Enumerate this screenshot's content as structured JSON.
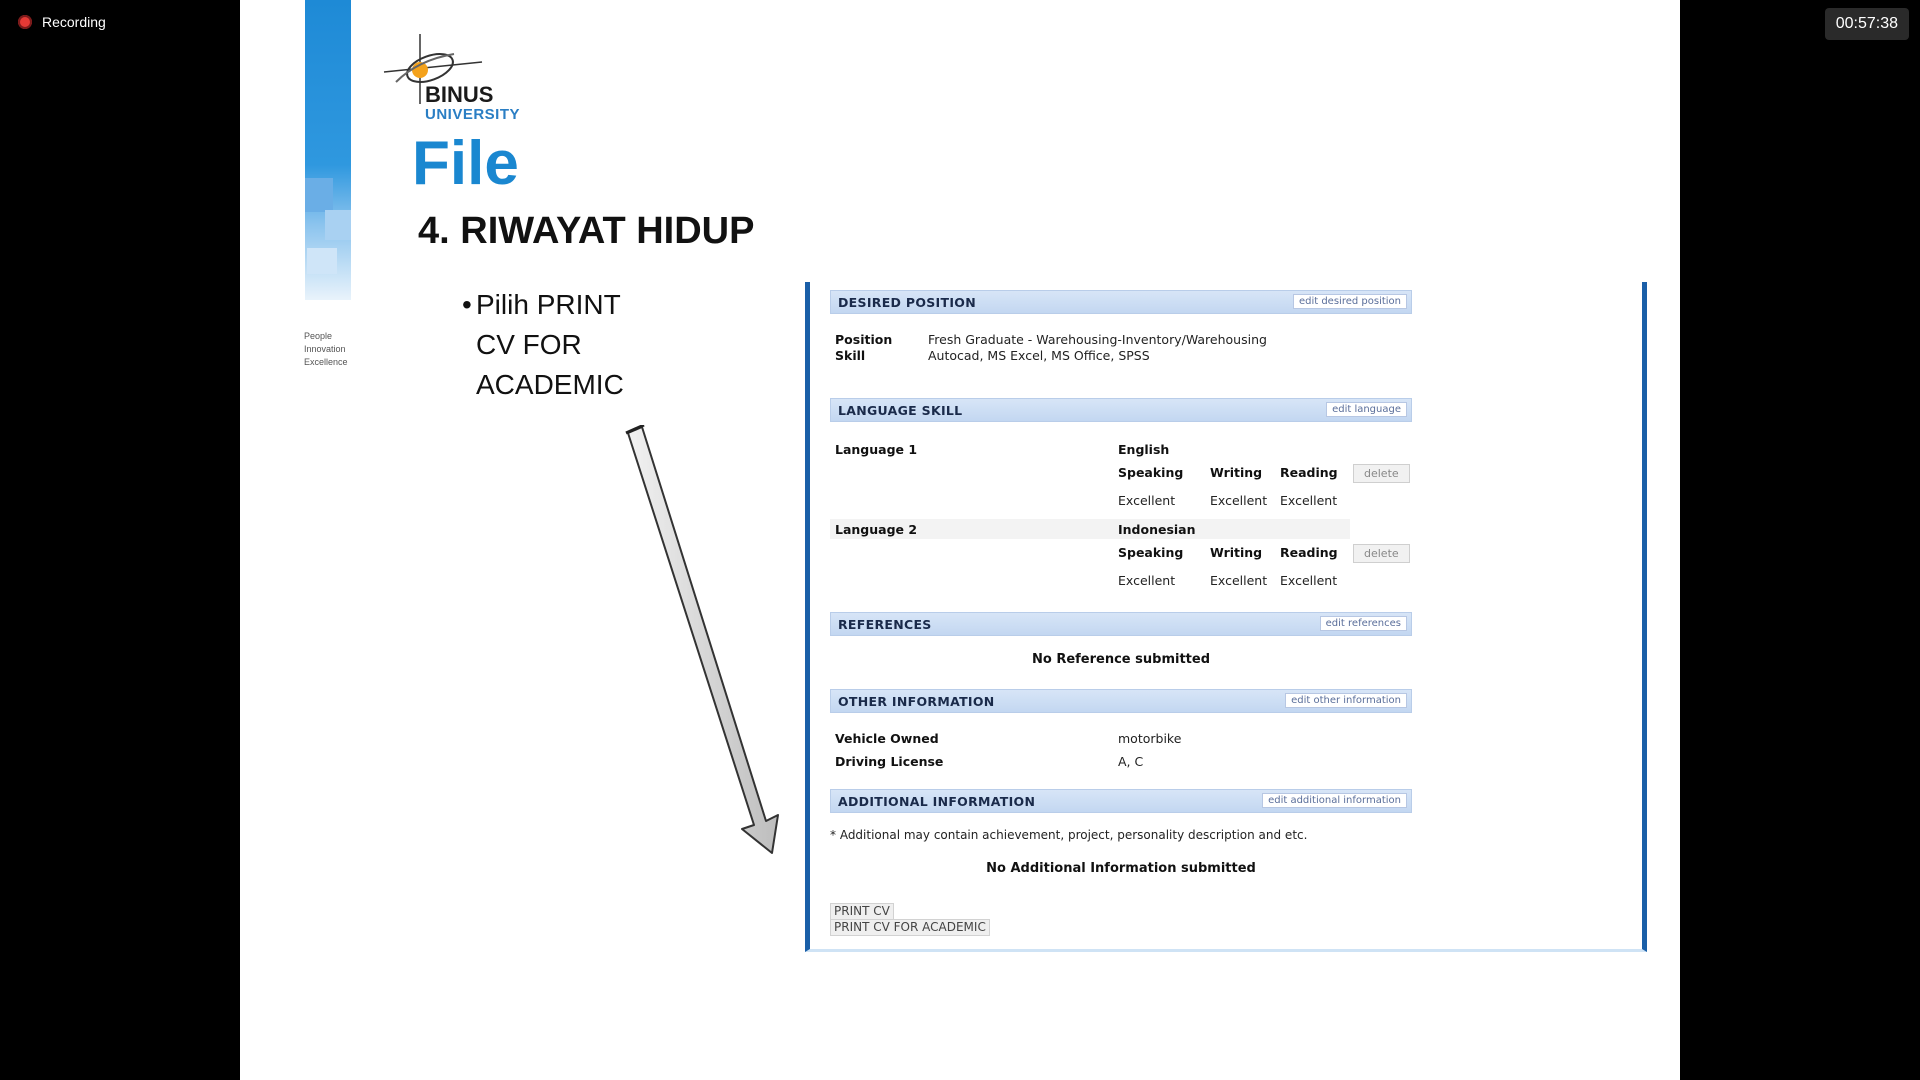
{
  "recording": {
    "label": "Recording",
    "timer": "00:57:38"
  },
  "slide": {
    "logo_main": "BINUS",
    "logo_sub": "UNIVERSITY",
    "tagline": [
      "People",
      "Innovation",
      "Excellence"
    ],
    "title": "File",
    "subtitle": "4. RIWAYAT HIDUP",
    "bullet_lines": [
      "Pilih PRINT",
      "CV FOR",
      "ACADEMIC"
    ]
  },
  "cv": {
    "desired_position": {
      "header": "DESIRED POSITION",
      "edit": "edit desired position",
      "position_label": "Position",
      "position_value": "Fresh Graduate - Warehousing-Inventory/Warehousing",
      "skill_label": "Skill",
      "skill_value": "Autocad, MS Excel, MS Office, SPSS"
    },
    "language_skill": {
      "header": "LANGUAGE SKILL",
      "edit": "edit language",
      "col_speaking": "Speaking",
      "col_writing": "Writing",
      "col_reading": "Reading",
      "delete_label": "delete",
      "languages": [
        {
          "label": "Language 1",
          "name": "English",
          "speaking": "Excellent",
          "writing": "Excellent",
          "reading": "Excellent"
        },
        {
          "label": "Language 2",
          "name": "Indonesian",
          "speaking": "Excellent",
          "writing": "Excellent",
          "reading": "Excellent"
        }
      ]
    },
    "references": {
      "header": "REFERENCES",
      "edit": "edit references",
      "empty": "No Reference submitted"
    },
    "other_information": {
      "header": "OTHER INFORMATION",
      "edit": "edit other information",
      "vehicle_label": "Vehicle Owned",
      "vehicle_value": "motorbike",
      "license_label": "Driving License",
      "license_value": "A, C"
    },
    "additional_information": {
      "header": "ADDITIONAL INFORMATION",
      "edit": "edit additional information",
      "note": "* Additional may contain achievement, project, personality description and etc.",
      "empty": "No Additional Information submitted"
    },
    "buttons": {
      "print_cv": "PRINT CV",
      "print_cv_academic": "PRINT CV FOR ACADEMIC"
    }
  }
}
